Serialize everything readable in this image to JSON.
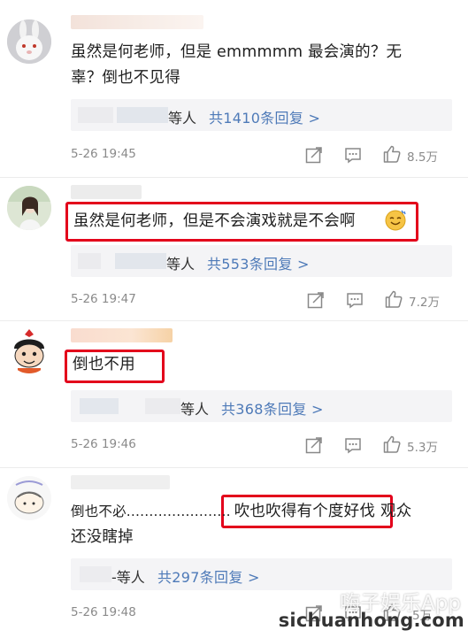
{
  "comments": [
    {
      "body_lines": [
        "虽然是何老师，但是 emmmmm 最会演的？无",
        "辜？倒也不见得"
      ],
      "reply": {
        "deng": "等人",
        "count": "共1410条回复 >"
      },
      "time": "5-26 19:45",
      "likes": "8.5万"
    },
    {
      "body_lines": [
        "虽然是何老师，但是不会演戏就是不会啊"
      ],
      "reply": {
        "deng": "等人",
        "count": "共553条回复 >"
      },
      "time": "5-26 19:47",
      "likes": "7.2万"
    },
    {
      "body_lines": [
        "倒也不用"
      ],
      "reply": {
        "deng": "等人",
        "count": "共368条回复 >"
      },
      "time": "5-26 19:46",
      "likes": "5.3万"
    },
    {
      "body_pre": "倒也不必.......................",
      "body_hl": "吹也吹得有个度好伐",
      "body_post": "观众",
      "body_line2": "还没瞎掉",
      "reply": {
        "deng": "-等人",
        "count": "共297条回复 >"
      },
      "time": "5-26 19:48",
      "likes": "5万"
    }
  ],
  "watermark": {
    "top": "嗨子娱乐App",
    "bottom": "sichuanhong.com"
  },
  "colors": {
    "link": "#4e7ab8",
    "highlight": "#e3001b",
    "meta": "#8a8a8a",
    "reply_bg": "#f4f4f6"
  },
  "icons": [
    "share-icon",
    "comment-icon",
    "like-icon",
    "emoji-smile-icon"
  ]
}
